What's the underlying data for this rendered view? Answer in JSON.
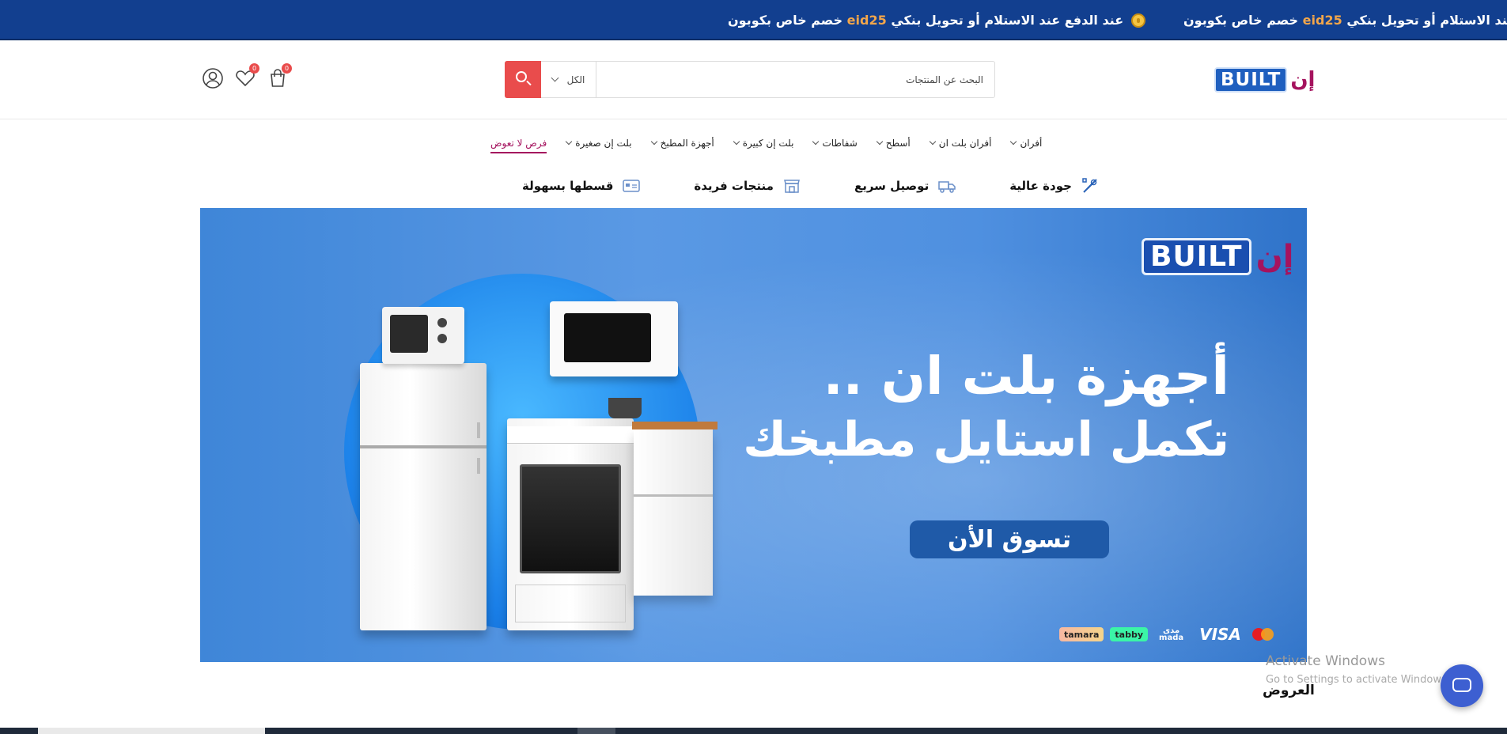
{
  "announcement": {
    "prefix": "خصم خاص بكوبون",
    "coupon": "eid25",
    "suffix": "عند الدفع عند الاستلام أو تحويل بنكي"
  },
  "header": {
    "logo_text": "BUILT",
    "logo_arabic": "إن",
    "search_placeholder": "البحث عن المنتجات",
    "category_selected": "الكل",
    "cart_count": "0",
    "wishlist_count": "0"
  },
  "nav": {
    "items": [
      {
        "label": "أفران"
      },
      {
        "label": "أفران بلت ان"
      },
      {
        "label": "أسطح"
      },
      {
        "label": "شفاطات"
      },
      {
        "label": "بلت إن كبيرة"
      },
      {
        "label": "أجهزة المطبخ"
      },
      {
        "label": "بلت إن صغيرة"
      }
    ],
    "deal_label": "فرص لا تعوض"
  },
  "features": [
    {
      "label": "جودة عالية",
      "icon": "tools-icon"
    },
    {
      "label": "توصيل سريع",
      "icon": "truck-icon"
    },
    {
      "label": "منتجات فريدة",
      "icon": "store-icon"
    },
    {
      "label": "قسطها بسهولة",
      "icon": "card-icon"
    }
  ],
  "banner": {
    "logo_text": "BUILT",
    "logo_arabic": "إن",
    "line1": "أجهزة بلت ان ..",
    "line2": "تكمل استايل مطبخك",
    "cta": "تسوق الأن",
    "payments": {
      "tamara": "tamara",
      "tabby": "tabby",
      "mada_ar": "مدى",
      "mada": "mada",
      "visa": "VISA"
    }
  },
  "section_title": "العروض",
  "watermark": {
    "title": "Activate Windows",
    "subtitle": "Go to Settings to activate Windows."
  },
  "colors": {
    "topbar": "#123f8f",
    "accent": "#e94c4c",
    "deal": "#a5135e",
    "banner": "#4f90e0"
  }
}
